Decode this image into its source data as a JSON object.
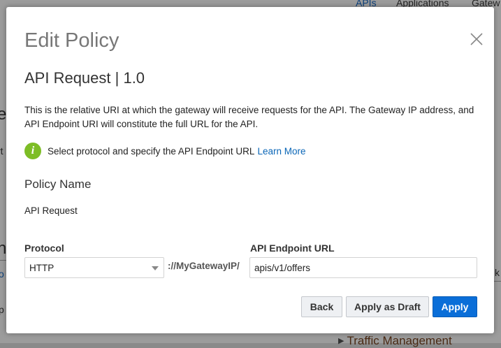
{
  "background": {
    "nav": {
      "apis": "APIs",
      "applications": "Applications",
      "gateways": "Gatew"
    },
    "fragments": {
      "e": "e",
      "rt": "rt",
      "n": "n",
      "c": "o",
      "p": "p",
      "k": "k"
    },
    "traffic_management": "Traffic Management"
  },
  "modal": {
    "title": "Edit Policy",
    "close_icon": "close-icon",
    "section_title": "API Request | 1.0",
    "description": "This is the relative URI at which the gateway will receive requests for the API. The Gateway IP address, and API Endpoint URI will constitute the full URL for the API.",
    "info": {
      "icon": "info-icon",
      "icon_glyph": "i",
      "text": "Select protocol and specify the API Endpoint URL",
      "link": "Learn More"
    },
    "policy_name": {
      "label": "Policy Name",
      "value": "API Request"
    },
    "protocol": {
      "label": "Protocol",
      "selected": "HTTP"
    },
    "gateway_prefix": "://MyGatewayIP/",
    "endpoint": {
      "label": "API Endpoint URL",
      "value": "apis/v1/offers"
    },
    "buttons": {
      "back": "Back",
      "save_draft": "Apply as Draft",
      "apply": "Apply"
    }
  },
  "colors": {
    "accent": "#0a6ed8",
    "link": "#0a66b7",
    "info_icon": "#7dbd26"
  }
}
